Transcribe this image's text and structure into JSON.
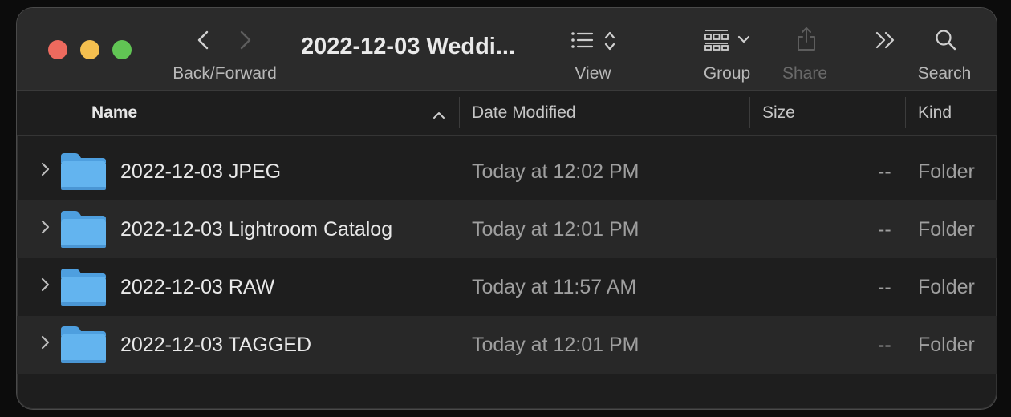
{
  "window": {
    "title": "2022-12-03 Weddi..."
  },
  "toolbar": {
    "back_forward_label": "Back/Forward",
    "view_label": "View",
    "group_label": "Group",
    "share_label": "Share",
    "search_label": "Search",
    "share_disabled": true
  },
  "columns": {
    "name": "Name",
    "date_modified": "Date Modified",
    "size": "Size",
    "kind": "Kind",
    "sort_column": "Name",
    "sort_direction": "ascending"
  },
  "rows": [
    {
      "name": "2022-12-03 JPEG",
      "date": "Today at 12:02 PM",
      "size": "--",
      "kind": "Folder"
    },
    {
      "name": "2022-12-03 Lightroom Catalog",
      "date": "Today at 12:01 PM",
      "size": "--",
      "kind": "Folder"
    },
    {
      "name": "2022-12-03 RAW",
      "date": "Today at 11:57 AM",
      "size": "--",
      "kind": "Folder"
    },
    {
      "name": "2022-12-03 TAGGED",
      "date": "Today at 12:01 PM",
      "size": "--",
      "kind": "Folder"
    }
  ],
  "colors": {
    "close": "#ed6a5e",
    "minimize": "#f4bf4f",
    "zoom": "#61c554",
    "folder": "#5fb2ee"
  }
}
